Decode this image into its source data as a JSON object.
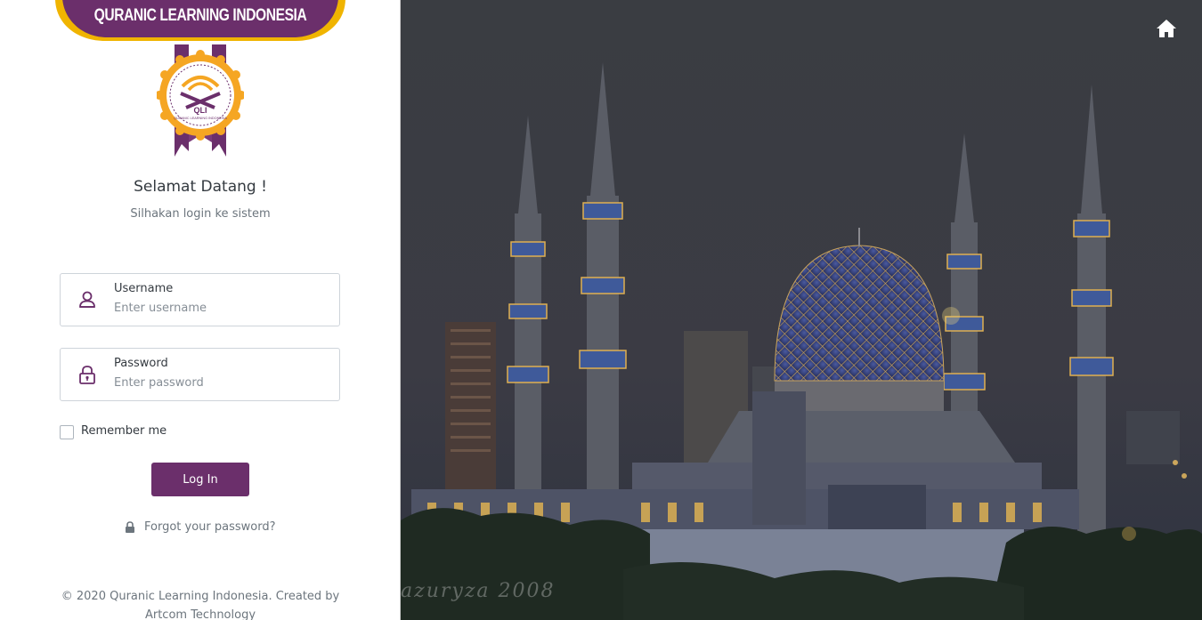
{
  "brand": {
    "name": "QURANIC LEARNING INDONESIA",
    "badge_text": "QLI",
    "badge_subtext": "QURANIC LEARNING INDONESIA"
  },
  "welcome": {
    "title": "Selamat Datang !",
    "subtitle": "Silhakan login ke sistem"
  },
  "form": {
    "username": {
      "label": "Username",
      "placeholder": "Enter username",
      "value": ""
    },
    "password": {
      "label": "Password",
      "placeholder": "Enter password",
      "value": ""
    },
    "remember_label": "Remember me",
    "remember_checked": false,
    "login_label": "Log In",
    "forgot_label": "Forgot your password?"
  },
  "footer": {
    "text": "© 2020 Quranic Learning Indonesia. Created by Artcom Technology"
  },
  "background": {
    "watermark": "azuryza 2008"
  },
  "colors": {
    "primary": "#6b2f6b",
    "accent": "#f5a623",
    "border": "#ced4da"
  },
  "icons": {
    "home": "home-icon",
    "user": "user-icon",
    "lock": "lock-icon"
  }
}
